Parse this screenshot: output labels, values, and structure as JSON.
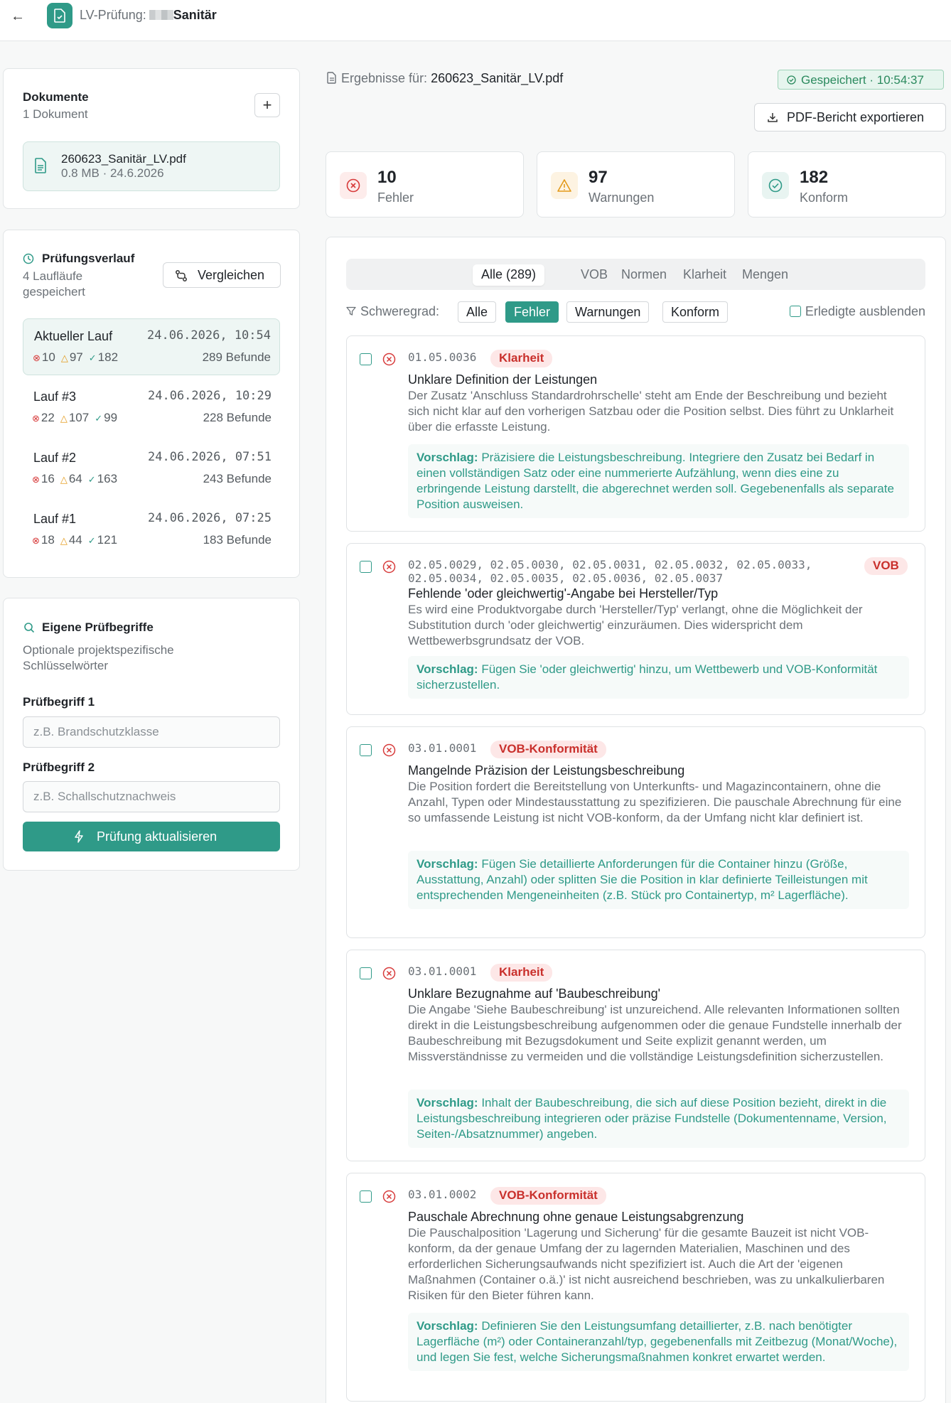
{
  "header": {
    "back_icon": "arrow-left-icon",
    "title_prefix": "LV-Prüfung:",
    "project": "Sanitär"
  },
  "documents": {
    "title": "Dokumente",
    "count": "1 Dokument",
    "add_label": "+",
    "file": {
      "name": "260623_Sanitär_LV.pdf",
      "meta": "0.8 MB · 24.6.2026"
    }
  },
  "history": {
    "title": "Prüfungsverlauf",
    "subtitle": "4 Laufläufe gespeichert",
    "compare_label": "Vergleichen",
    "runs": [
      {
        "name": "Aktueller Lauf",
        "date": "24.06.2026, 10:54",
        "errors": "10",
        "warnings": "97",
        "ok": "182",
        "count": "289 Befunde"
      },
      {
        "name": "Lauf #3",
        "date": "24.06.2026, 10:29",
        "errors": "22",
        "warnings": "107",
        "ok": "99",
        "count": "228 Befunde"
      },
      {
        "name": "Lauf #2",
        "date": "24.06.2026, 07:51",
        "errors": "16",
        "warnings": "64",
        "ok": "163",
        "count": "243 Befunde"
      },
      {
        "name": "Lauf #1",
        "date": "24.06.2026, 07:25",
        "errors": "18",
        "warnings": "44",
        "ok": "121",
        "count": "183 Befunde"
      }
    ]
  },
  "terms": {
    "title": "Eigene Prüfbegriffe",
    "description": "Optionale projektspezifische Schlüsselwörter",
    "term1_label": "Prüfbegriff 1",
    "term1_placeholder": "z.B. Brandschutzklasse",
    "term2_label": "Prüfbegriff 2",
    "term2_placeholder": "z.B. Schallschutznachweis",
    "update_label": "Prüfung aktualisieren"
  },
  "results": {
    "prefix": "Ergebnisse für:",
    "file": "260623_Sanitär_LV.pdf",
    "saved": "Gespeichert · 10:54:37",
    "export_label": "PDF-Bericht exportieren"
  },
  "stats": [
    {
      "value": "10",
      "label": "Fehler",
      "color": "#d73a3a",
      "bg": "#fdeceb"
    },
    {
      "value": "97",
      "label": "Warnungen",
      "color": "#e39a1a",
      "bg": "#fdf3e2"
    },
    {
      "value": "182",
      "label": "Konform",
      "color": "#2f9a88",
      "bg": "#e8f4f1"
    }
  ],
  "tabs": [
    "Alle (289)",
    "VOB",
    "Normen",
    "Klarheit",
    "Mengen"
  ],
  "filter": {
    "label": "Schweregrad:",
    "chips": [
      "Alle",
      "Fehler",
      "Warnungen",
      "Konform"
    ],
    "hide_done": "Erledigte ausblenden"
  },
  "suggestion_label": "Vorschlag:",
  "findings": [
    {
      "positions": "01.05.0036",
      "badge": "Klarheit",
      "title": "Unklare Definition der Leistungen",
      "description": "Der Zusatz 'Anschluss Standardrohrschelle' steht am Ende der Beschreibung und bezieht sich nicht klar auf den vorherigen Satzbau oder die Position selbst. Dies führt zu Unklarheit über die erfasste Leistung.",
      "suggestion": "Präzisiere die Leistungsbeschreibung. Integriere den Zusatz bei Bedarf in einen vollständigen Satz oder eine nummerierte Aufzählung, wenn dies eine zu erbringende Leistung darstellt, die abgerechnet werden soll. Gegebenenfalls als separate Position ausweisen."
    },
    {
      "positions": "02.05.0029, 02.05.0030, 02.05.0031, 02.05.0032, 02.05.0033, 02.05.0034, 02.05.0035, 02.05.0036, 02.05.0037",
      "badge": "VOB",
      "title": "Fehlende 'oder gleichwertig'-Angabe bei Hersteller/Typ",
      "description": "Es wird eine Produktvorgabe durch 'Hersteller/Typ' verlangt, ohne die Möglichkeit der Substitution durch 'oder gleichwertig' einzuräumen. Dies widerspricht dem Wettbewerbsgrundsatz der VOB.",
      "suggestion": "Fügen Sie 'oder gleichwertig' hinzu, um Wettbewerb und VOB-Konformität sicherzustellen."
    },
    {
      "positions": "03.01.0001",
      "badge": "VOB-Konformität",
      "title": "Mangelnde Präzision der Leistungsbeschreibung",
      "description": "Die Position fordert die Bereitstellung von Unterkunfts- und Magazincontainern, ohne die Anzahl, Typen oder Mindestausstattung zu spezifizieren. Die pauschale Abrechnung für eine so umfassende Leistung ist nicht VOB-konform, da der Umfang nicht klar definiert ist.",
      "suggestion": "Fügen Sie detaillierte Anforderungen für die Container hinzu (Größe, Ausstattung, Anzahl) oder splitten Sie die Position in klar definierte Teilleistungen mit entsprechenden Mengeneinheiten (z.B. Stück pro Containertyp, m² Lagerfläche)."
    },
    {
      "positions": "03.01.0001",
      "badge": "Klarheit",
      "title": "Unklare Bezugnahme auf 'Baubeschreibung'",
      "description": "Die Angabe 'Siehe Baubeschreibung' ist unzureichend. Alle relevanten Informationen sollten direkt in die Leistungsbeschreibung aufgenommen oder die genaue Fundstelle innerhalb der Baubeschreibung mit Bezugsdokument und Seite explizit genannt werden, um Missverständnisse zu vermeiden und die vollständige Leistungsdefinition sicherzustellen.",
      "suggestion": "Inhalt der Baubeschreibung, die sich auf diese Position bezieht, direkt in die Leistungsbeschreibung integrieren oder präzise Fundstelle (Dokumentenname, Version, Seiten-/Absatznummer) angeben."
    },
    {
      "positions": "03.01.0002",
      "badge": "VOB-Konformität",
      "title": "Pauschale Abrechnung ohne genaue Leistungsabgrenzung",
      "description": "Die Pauschalposition 'Lagerung und Sicherung' für die gesamte Bauzeit ist nicht VOB-konform, da der genaue Umfang der zu lagernden Materialien, Maschinen und des erforderlichen Sicherungsaufwands nicht spezifiziert ist. Auch die Art der 'eigenen Maßnahmen (Container o.ä.)' ist nicht ausreichend beschrieben, was zu unkalkulierbaren Risiken für den Bieter führen kann.",
      "suggestion": "Definieren Sie den Leistungsumfang detaillierter, z.B. nach benötigter Lagerfläche (m²) oder Containeranzahl/typ, gegebenenfalls mit Zeitbezug (Monat/Woche), und legen Sie fest, welche Sicherungsmaßnahmen konkret erwartet werden."
    }
  ]
}
